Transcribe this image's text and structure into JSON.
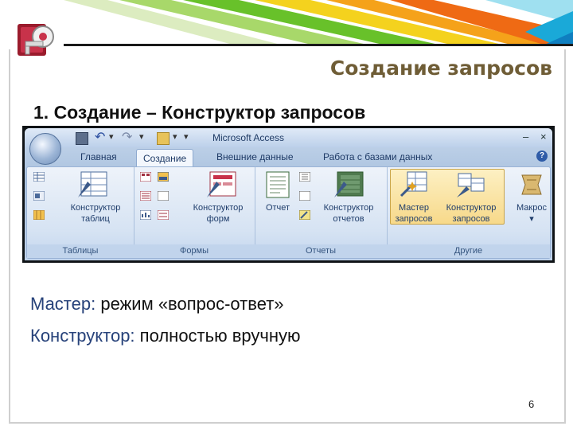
{
  "slide": {
    "title": "Создание запросов",
    "subtitle": "1. Создание – Конструктор запросов",
    "page_number": "6",
    "lines": [
      {
        "key": "Мастер:",
        "value": " режим «вопрос-ответ»"
      },
      {
        "key": "Конструктор:",
        "value": " полностью вручную"
      }
    ]
  },
  "app": {
    "window_title": "Microsoft Access",
    "qat_separator": "▾",
    "win_minimize": "–",
    "win_close": "×",
    "help": "?"
  },
  "tabs": [
    {
      "label": "Главная",
      "active": false
    },
    {
      "label": "Создание",
      "active": true
    },
    {
      "label": "Внешние данные",
      "active": false
    },
    {
      "label": "Работа с базами данных",
      "active": false
    }
  ],
  "groups": [
    {
      "label": "Таблицы",
      "buttons": [
        {
          "line1": "Конструктор",
          "line2": "таблиц"
        }
      ]
    },
    {
      "label": "Формы",
      "buttons": [
        {
          "line1": "Конструктор",
          "line2": "форм"
        }
      ]
    },
    {
      "label": "Отчеты",
      "buttons": [
        {
          "line1": "Отчет",
          "line2": ""
        },
        {
          "line1": "Конструктор",
          "line2": "отчетов"
        }
      ]
    },
    {
      "label": "Другие",
      "buttons": [
        {
          "line1": "Мастер",
          "line2": "запросов"
        },
        {
          "line1": "Конструктор",
          "line2": "запросов"
        },
        {
          "line1": "Макрос",
          "line2": "▾"
        }
      ]
    }
  ],
  "colors": {
    "title": "#6f5d36",
    "key_text": "#27427a",
    "ribbon_highlight": "#f7d98a"
  }
}
